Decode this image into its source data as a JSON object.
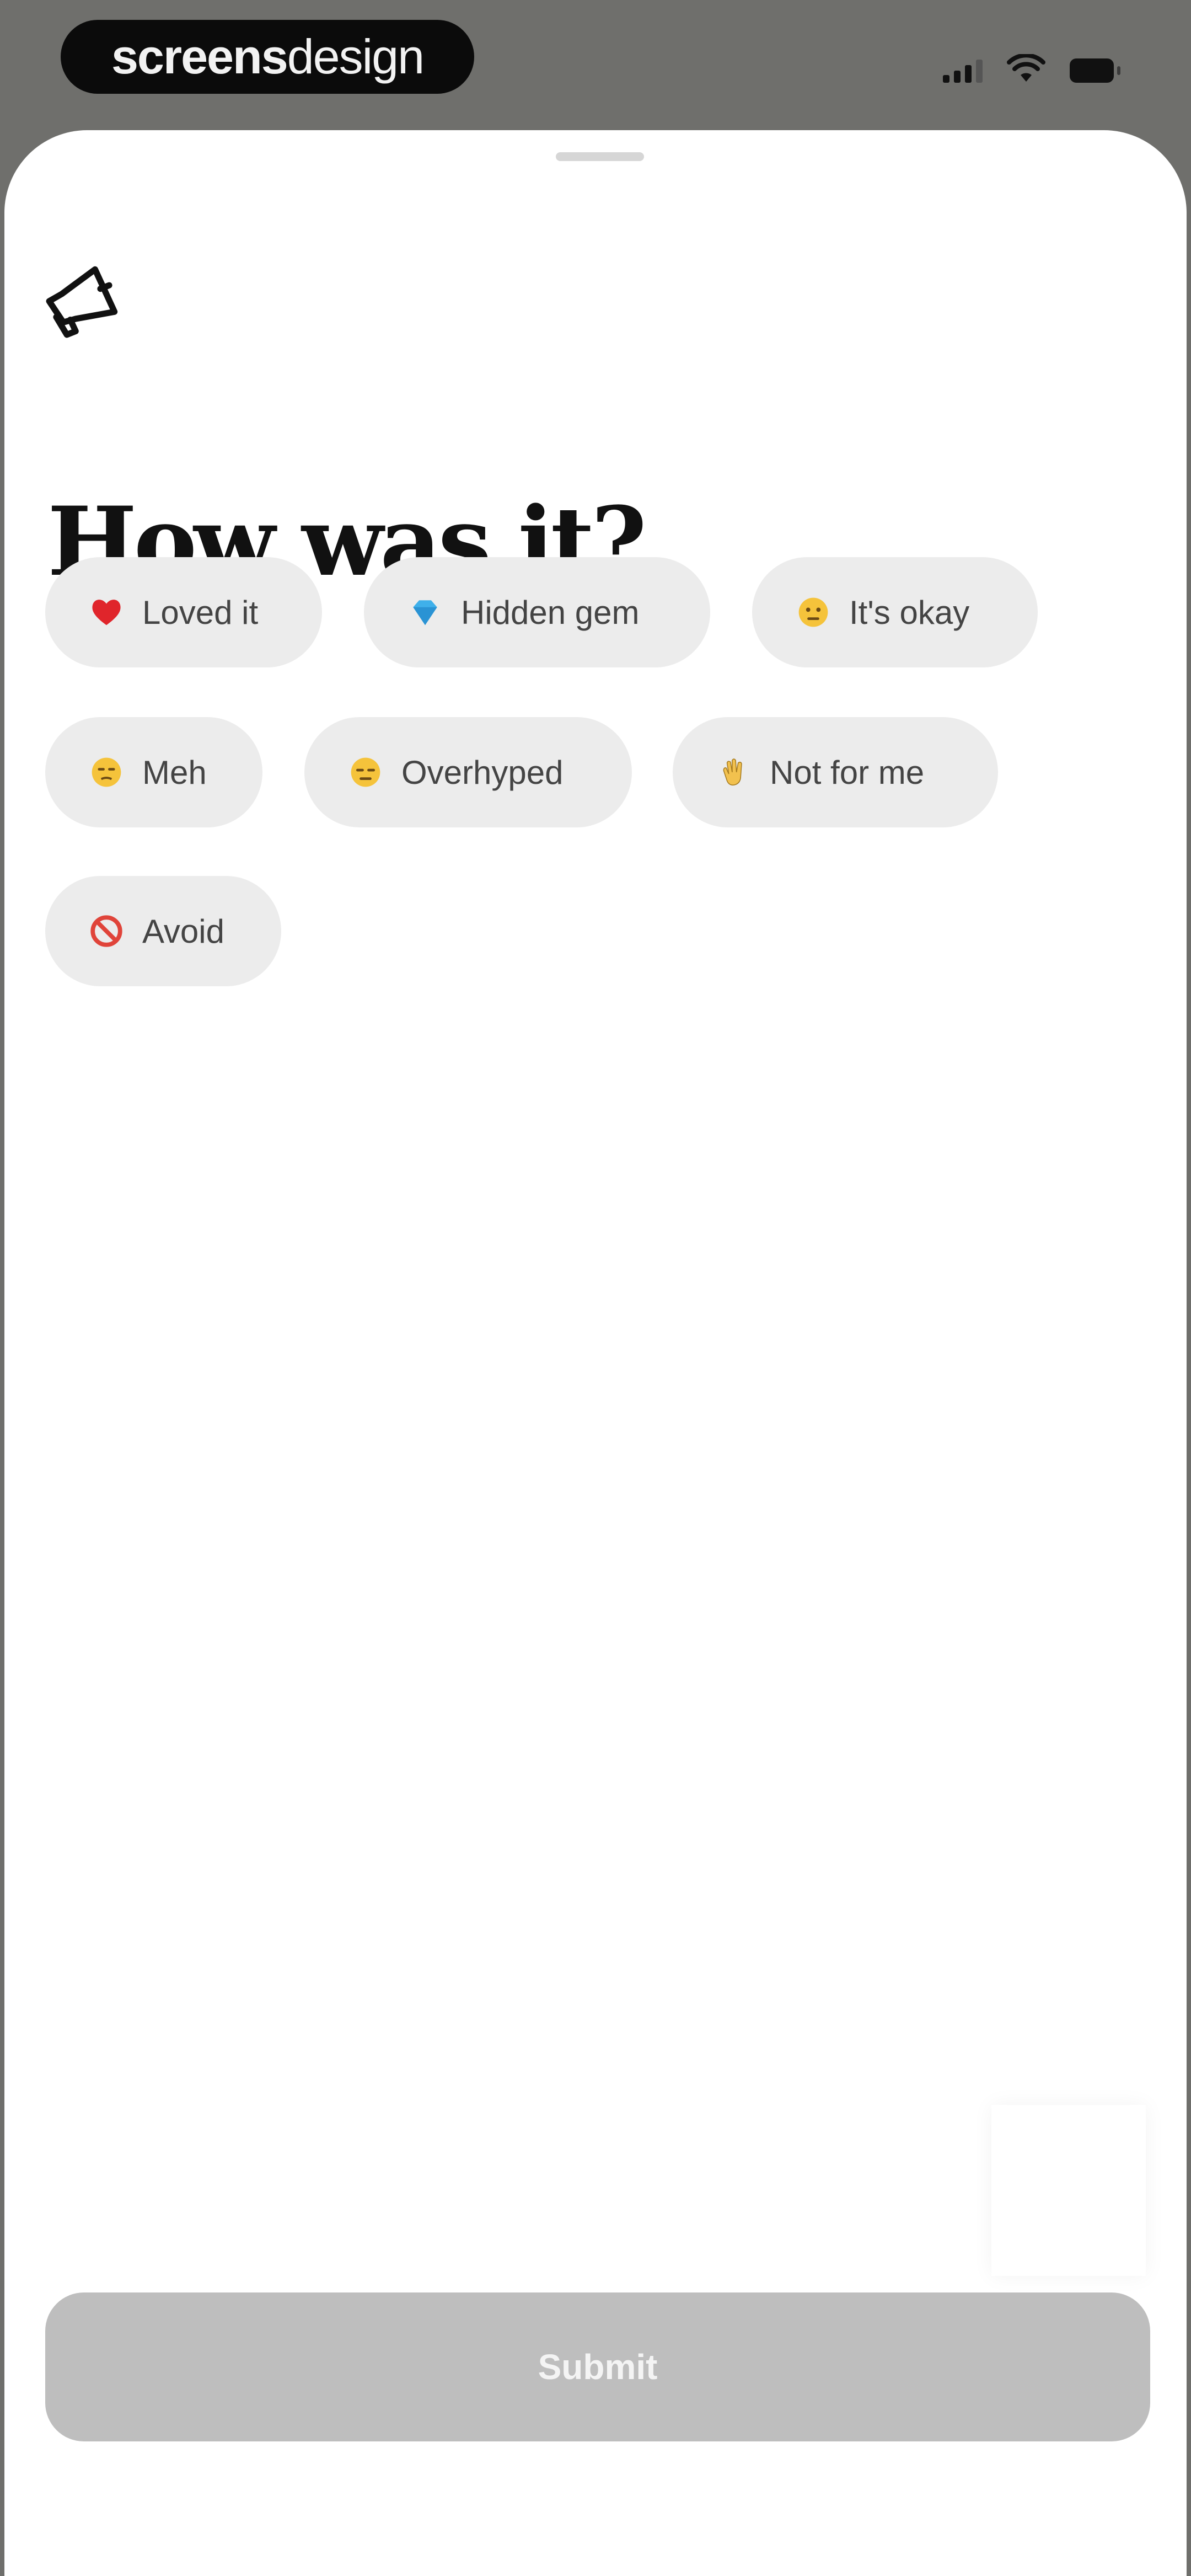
{
  "status_bar": {
    "watermark_bold": "screens",
    "watermark_light": "design",
    "icons": [
      "cellular-signal-icon",
      "wifi-icon",
      "battery-icon"
    ]
  },
  "sheet": {
    "header_icon": "megaphone-icon",
    "title": "How was it?",
    "options": [
      {
        "label": "Loved it",
        "icon": "red-heart-icon"
      },
      {
        "label": "Hidden gem",
        "icon": "gem-icon"
      },
      {
        "label": "It's okay",
        "icon": "neutral-face-icon"
      },
      {
        "label": "Meh",
        "icon": "unamused-face-icon"
      },
      {
        "label": "Overhyped",
        "icon": "expressionless-face-icon"
      },
      {
        "label": "Not for me",
        "icon": "waving-hand-icon"
      },
      {
        "label": "Avoid",
        "icon": "no-entry-icon"
      }
    ],
    "submit_label": "Submit",
    "submit_enabled": false
  },
  "colors": {
    "backdrop": "#6f6f6c",
    "sheet": "#ffffff",
    "chip": "#ececec",
    "chip_text": "#444444",
    "submit_disabled": "#bebebe"
  }
}
